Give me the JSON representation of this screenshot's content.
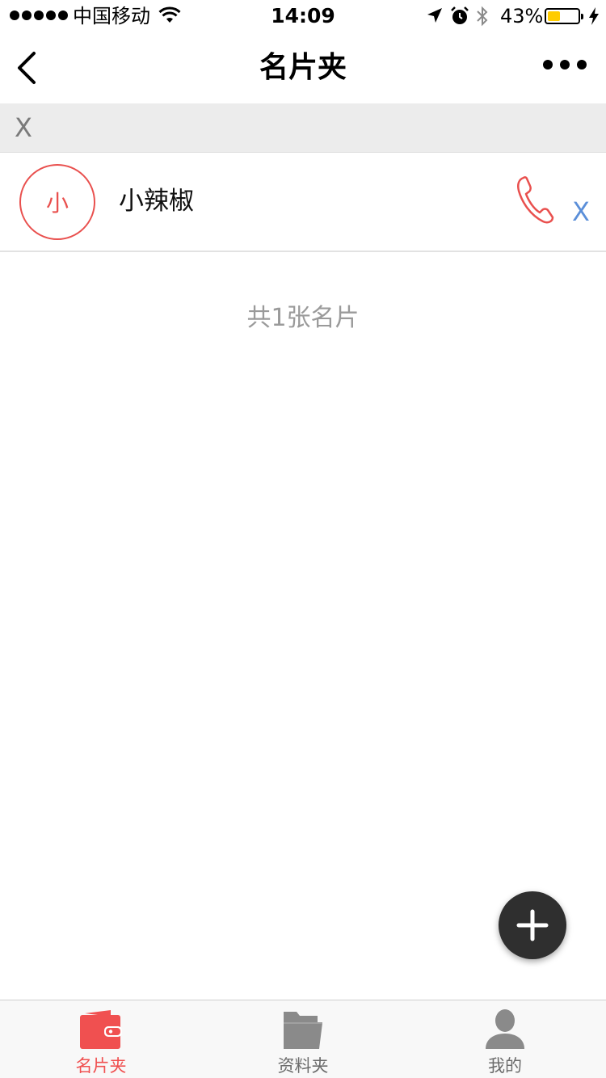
{
  "status_bar": {
    "carrier": "中国移动",
    "time": "14:09",
    "battery_percent_text": "43%",
    "battery_level": 0.43,
    "icons": [
      "signal-dots",
      "wifi-icon",
      "location-arrow-icon",
      "alarm-icon",
      "bluetooth-icon",
      "battery-icon",
      "charging-bolt-icon"
    ]
  },
  "nav": {
    "title": "名片夹",
    "back_icon": "chevron-left-icon",
    "more_icon": "ellipsis-icon"
  },
  "search": {
    "clear_label": "X"
  },
  "contacts": [
    {
      "avatar_char": "小",
      "name": "小辣椒",
      "phone_icon": "phone-icon",
      "delete_label": "X"
    }
  ],
  "count_text": "共1张名片",
  "fab": {
    "icon": "plus-icon"
  },
  "tabs": [
    {
      "label": "名片夹",
      "icon": "wallet-icon",
      "active": true
    },
    {
      "label": "资料夹",
      "icon": "folder-icon",
      "active": false
    },
    {
      "label": "我的",
      "icon": "person-icon",
      "active": false
    }
  ],
  "colors": {
    "accent": "#e9504e",
    "tab_active": "#f05050",
    "link_blue": "#5b8fd9",
    "fab_bg": "#2f2f2f",
    "muted_text": "#9a9a9a",
    "search_bg": "#ececec"
  }
}
